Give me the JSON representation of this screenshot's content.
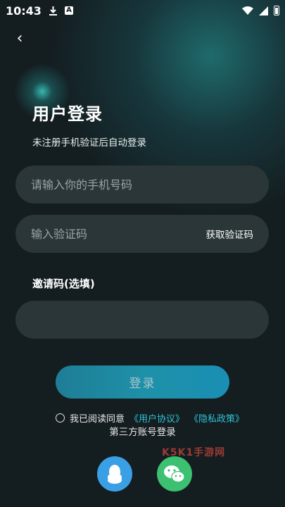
{
  "status_bar": {
    "time": "10:43",
    "download_icon": "download-icon",
    "app_icon_letter": "A",
    "wifi_icon": "wifi-icon",
    "signal_icon": "signal-icon",
    "battery_icon": "battery-icon"
  },
  "nav": {
    "back_icon": "‹"
  },
  "header": {
    "title": "用户登录",
    "subtitle": "未注册手机验证后自动登录"
  },
  "form": {
    "phone_placeholder": "请输入你的手机号码",
    "code_placeholder": "输入验证码",
    "get_code_label": "获取验证码",
    "invite_label": "邀请码(选填)",
    "invite_placeholder": ""
  },
  "actions": {
    "login_label": "登录"
  },
  "agreement": {
    "prefix": "我已阅读同意",
    "user_agreement": "《用户协议》",
    "privacy_policy": "《隐私政策》",
    "checked": false
  },
  "third_party": {
    "title": "第三方账号登录",
    "providers": [
      "qq-icon",
      "wechat-icon"
    ]
  },
  "watermark": {
    "text": "K5K1手游网"
  },
  "colors": {
    "background": "#141d20",
    "field": "#2a3638",
    "accent": "#1e90a8",
    "link": "#2fc3d6",
    "qq": "#3aa0e6",
    "wechat": "#3cc071"
  }
}
